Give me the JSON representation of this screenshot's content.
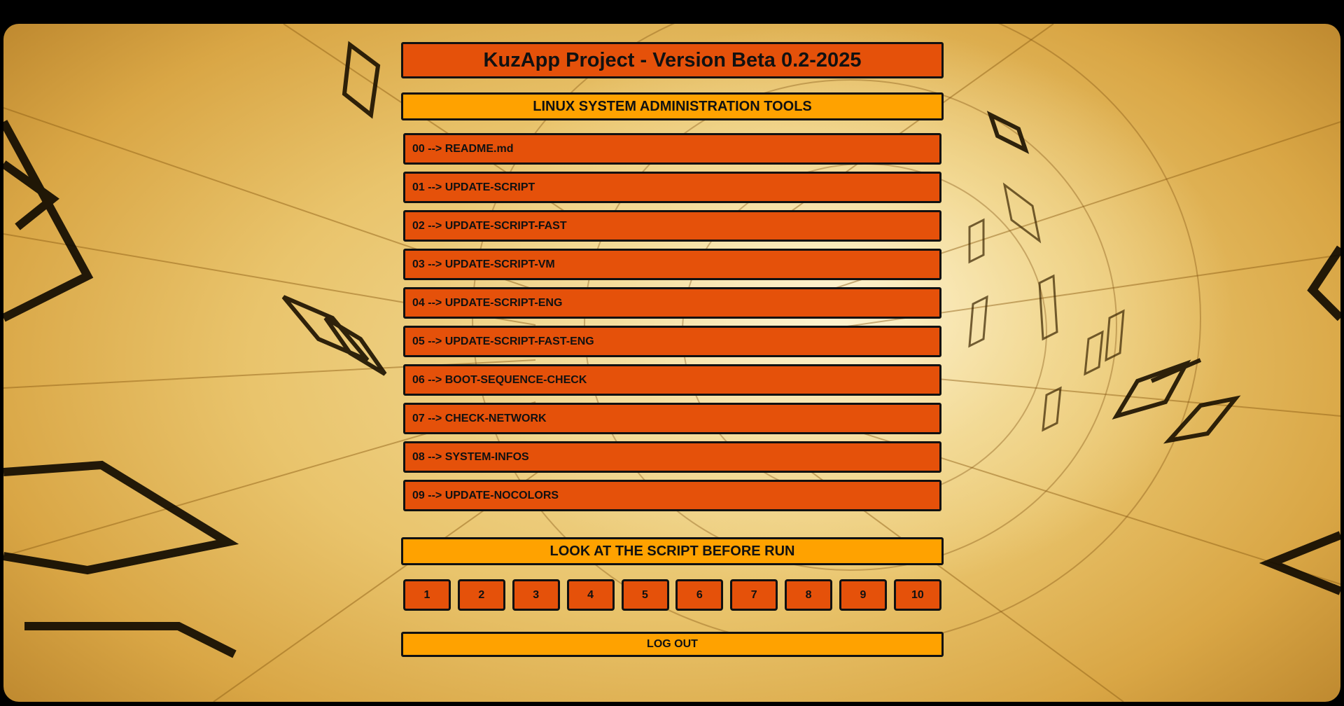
{
  "app": {
    "title": "KuzApp Project - Version Beta 0.2-2025"
  },
  "tools": {
    "header": "LINUX SYSTEM ADMINISTRATION TOOLS",
    "items": [
      {
        "label": "00 --> README.md"
      },
      {
        "label": "01 --> UPDATE-SCRIPT"
      },
      {
        "label": "02 --> UPDATE-SCRIPT-FAST"
      },
      {
        "label": "03 --> UPDATE-SCRIPT-VM"
      },
      {
        "label": "04 --> UPDATE-SCRIPT-ENG"
      },
      {
        "label": "05 --> UPDATE-SCRIPT-FAST-ENG"
      },
      {
        "label": "06 --> BOOT-SEQUENCE-CHECK"
      },
      {
        "label": "07 --> CHECK-NETWORK"
      },
      {
        "label": "08 --> SYSTEM-INFOS"
      },
      {
        "label": "09 --> UPDATE-NOCOLORS"
      }
    ]
  },
  "script_viewer": {
    "header": "LOOK AT THE SCRIPT BEFORE RUN",
    "buttons": [
      "1",
      "2",
      "3",
      "4",
      "5",
      "6",
      "7",
      "8",
      "9",
      "10"
    ]
  },
  "logout": {
    "label": "LOG OUT"
  },
  "colors": {
    "primary_orange": "#e5510a",
    "header_amber": "#ffa200",
    "border": "#111111",
    "outer_frame": "#000000"
  }
}
